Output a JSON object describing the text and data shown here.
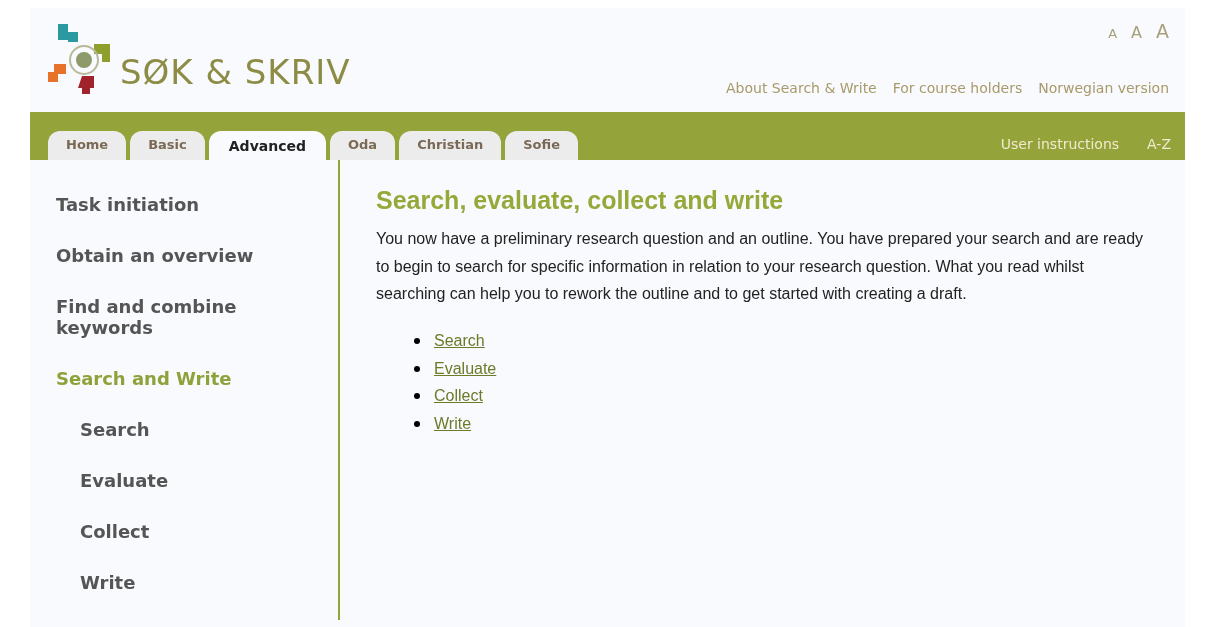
{
  "logo": {
    "text": "SØK & SKRIV"
  },
  "font_sizes": [
    "A",
    "A",
    "A"
  ],
  "top_links": [
    "About Search & Write",
    "For course holders",
    "Norwegian version"
  ],
  "tabs": [
    {
      "label": "Home",
      "selected": false
    },
    {
      "label": "Basic",
      "selected": false
    },
    {
      "label": "Advanced",
      "selected": true
    },
    {
      "label": "Oda",
      "selected": false
    },
    {
      "label": "Christian",
      "selected": false
    },
    {
      "label": "Sofie",
      "selected": false
    }
  ],
  "bar_links": [
    "User instructions",
    "A-Z"
  ],
  "sidebar": {
    "items": [
      {
        "label": "Task initiation",
        "selected": false
      },
      {
        "label": "Obtain an overview",
        "selected": false
      },
      {
        "label": "Find and combine keywords",
        "selected": false
      },
      {
        "label": "Search and Write",
        "selected": true,
        "children": [
          {
            "label": "Search",
            "selected": false
          },
          {
            "label": "Evaluate",
            "selected": false
          },
          {
            "label": "Collect",
            "selected": false
          },
          {
            "label": "Write",
            "selected": false
          }
        ]
      }
    ]
  },
  "content": {
    "heading": "Search, evaluate, collect and write",
    "paragraph": "You now have a preliminary research question and an outline. You have prepared your search and are ready to begin to search for specific information in relation to your research question. What you read whilst searching can help you to rework the outline and to get started with creating a draft.",
    "links": [
      "Search",
      "Evaluate",
      "Collect",
      "Write"
    ]
  }
}
